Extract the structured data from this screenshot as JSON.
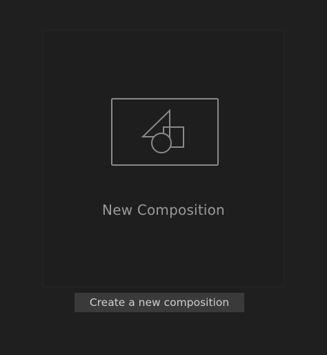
{
  "composition_card": {
    "label": "New Composition",
    "icon": "composition-shapes-icon"
  },
  "tooltip": {
    "text": "Create a new composition"
  },
  "colors": {
    "background": "#1f1f1f",
    "icon_stroke": "#8a8a8a",
    "label": "#9a9a9a",
    "tooltip_bg": "#3a3a3a",
    "tooltip_text": "#cfcfcf"
  }
}
